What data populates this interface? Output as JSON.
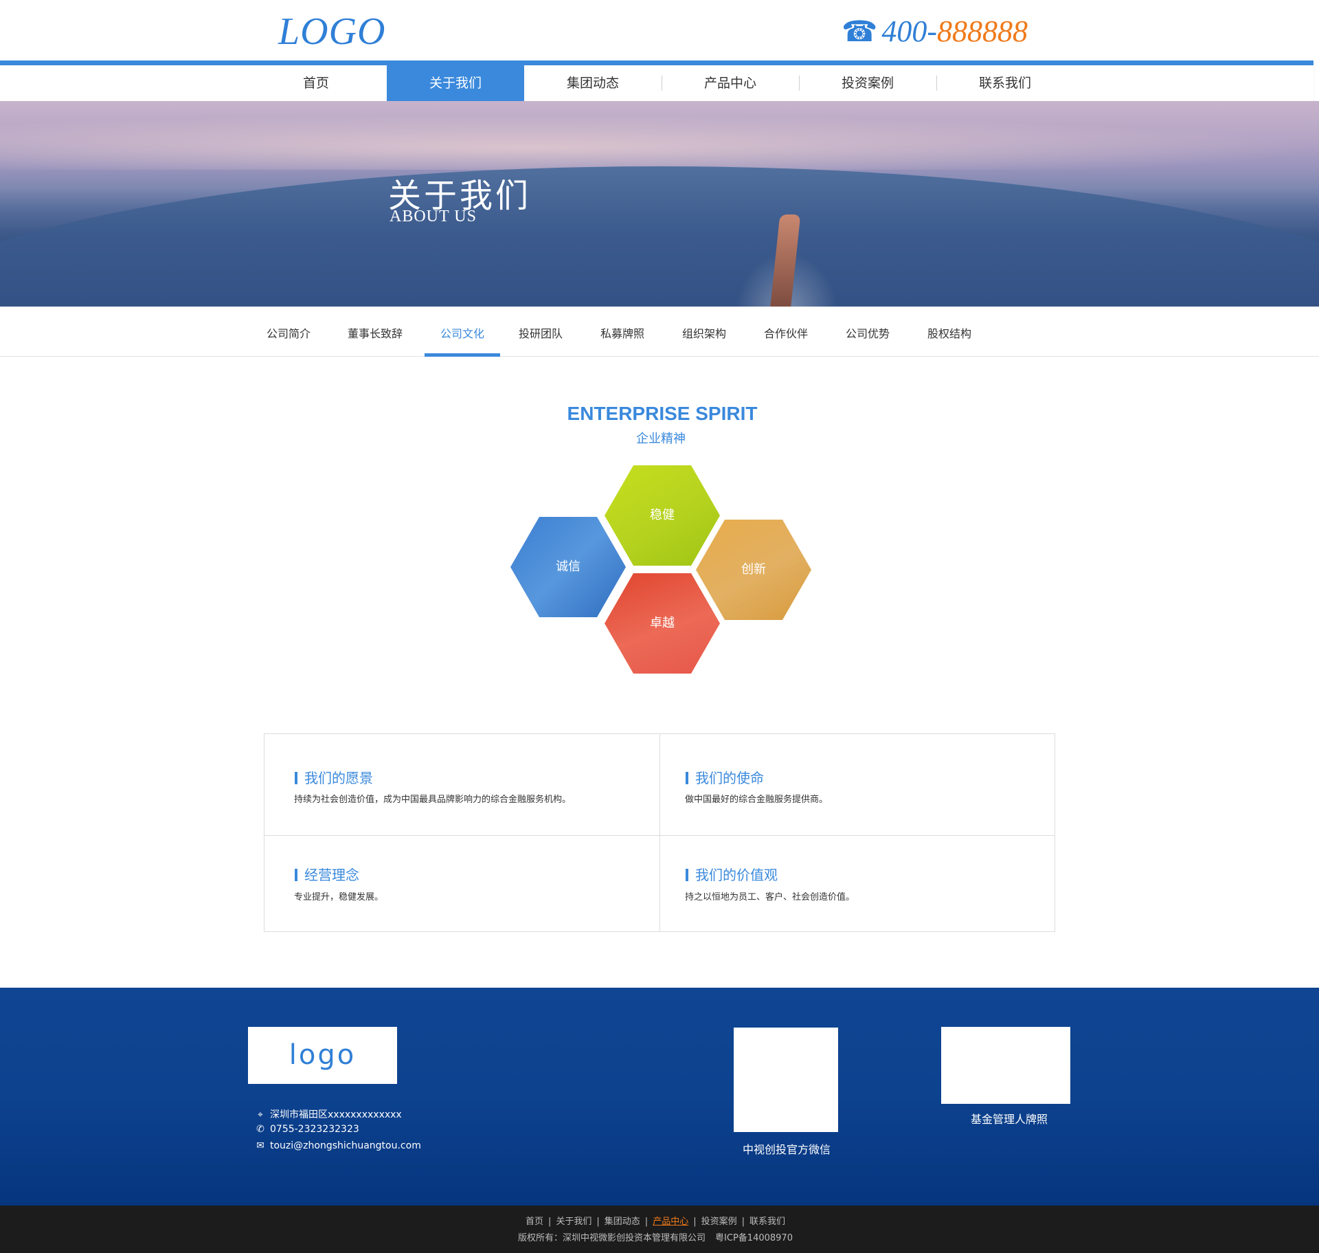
{
  "header": {
    "logo": "LOGO",
    "phone_prefix": "400-",
    "phone_number": "888888",
    "phone_icon": "telephone-icon"
  },
  "nav": {
    "items": [
      "首页",
      "关于我们",
      "集团动态",
      "产品中心",
      "投资案例",
      "联系我们"
    ],
    "active": "关于我们"
  },
  "banner": {
    "title": "关于我们",
    "subtitle": "ABOUT US"
  },
  "subnav": {
    "items": [
      "公司简介",
      "董事长致辞",
      "公司文化",
      "投研团队",
      "私募牌照",
      "组织架构",
      "合作伙伴",
      "公司优势",
      "股权结构"
    ],
    "active": "公司文化"
  },
  "spirit": {
    "title": "ENTERPRISE SPIRIT",
    "subtitle": "企业精神",
    "hexes": [
      "稳健",
      "诚信",
      "创新",
      "卓越"
    ]
  },
  "cards": [
    {
      "title": "我们的愿景",
      "text": "持续为社会创造价值，成为中国最具品牌影响力的综合金融服务机构。"
    },
    {
      "title": "我们的使命",
      "text": "做中国最好的综合金融服务提供商。"
    },
    {
      "title": "经营理念",
      "text": "专业提升，稳健发展。"
    },
    {
      "title": "我们的价值观",
      "text": "持之以恒地为员工、客户、社会创造价值。"
    }
  ],
  "footer": {
    "logo": "logo",
    "address": "深圳市福田区xxxxxxxxxxxxx",
    "phone": "0755-2323232323",
    "email": "touzi@zhongshichuangtou.com",
    "qr1_caption": "中视创投官方微信",
    "qr2_caption": "基金管理人牌照",
    "icons": [
      "location-icon",
      "phone-icon",
      "mail-icon"
    ]
  },
  "bottom": {
    "links": [
      "首页",
      "关于我们",
      "集团动态",
      "产品中心",
      "投资案例",
      "联系我们"
    ],
    "highlight": "产品中心",
    "copyright": "版权所有：深圳中视微影创投资本管理有限公司",
    "icp": "粤ICP备14008970"
  },
  "colors": {
    "accent": "#3a89dc",
    "orange": "#f07a1a",
    "footer_blue": "#0d428f",
    "bottom_dark": "#1c1c1c"
  }
}
